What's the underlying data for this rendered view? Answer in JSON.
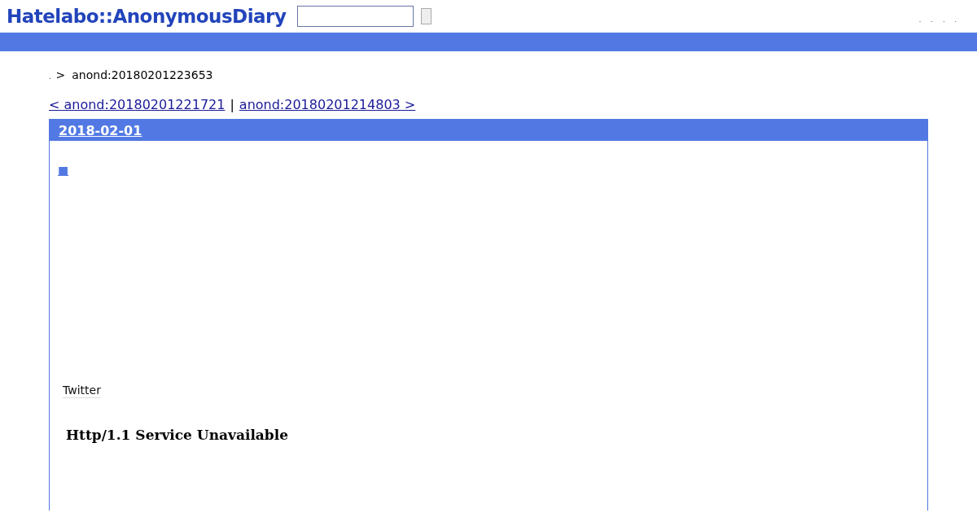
{
  "header": {
    "logo": "Hatelabo::AnonymousDiary",
    "links": [
      ".",
      ".",
      ".",
      "."
    ]
  },
  "breadcrumb": {
    "home": ".",
    "separator": ">",
    "current": "anond:20180201223653"
  },
  "pager": {
    "prev": "< anond:20180201221721",
    "divider": "|",
    "next": "anond:20180201214803 >"
  },
  "entry": {
    "date": "2018-02-01",
    "marker": "■",
    "share": "Twitter",
    "error": "Http/1.1 Service Unavailable"
  }
}
